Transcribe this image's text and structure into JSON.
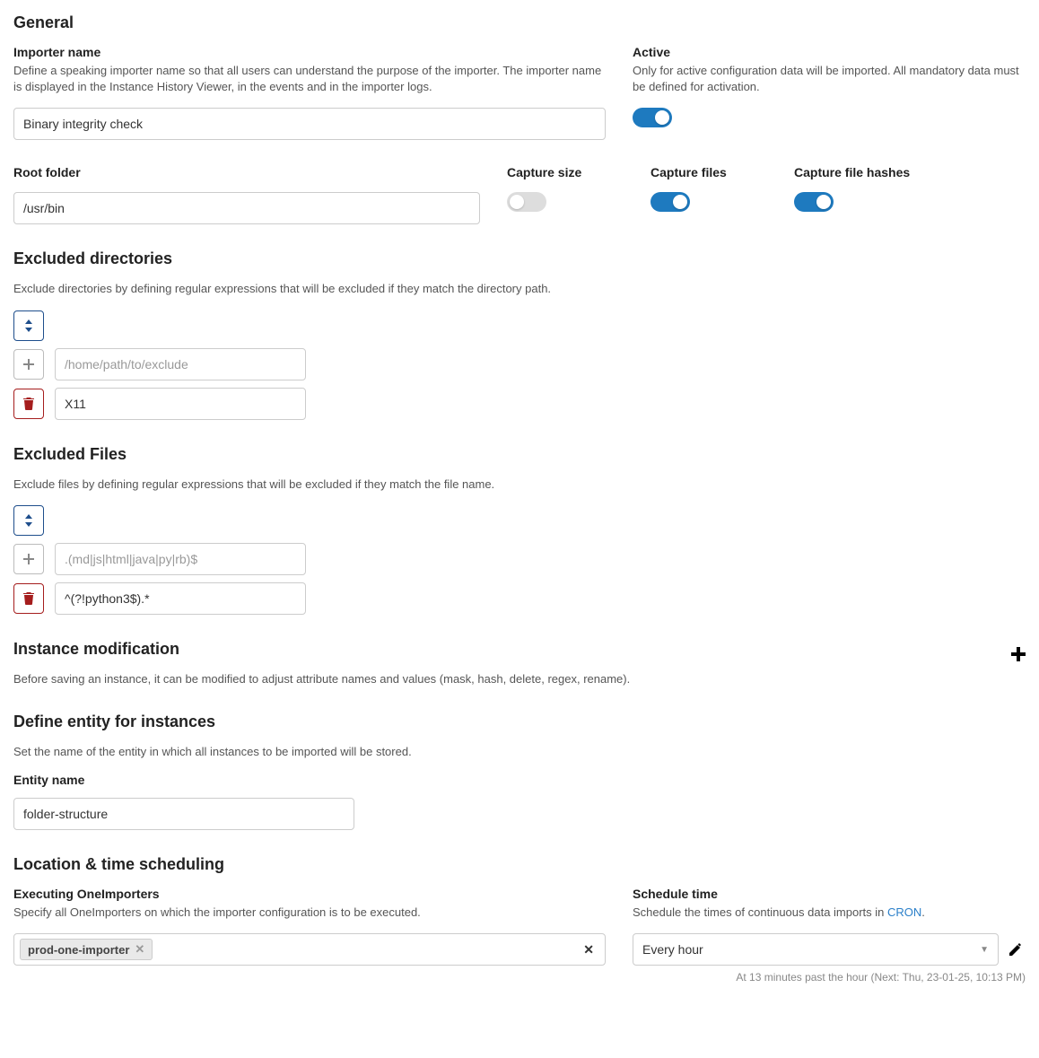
{
  "general": {
    "heading": "General",
    "importer_name": {
      "label": "Importer name",
      "desc": "Define a speaking importer name so that all users can understand the purpose of the importer. The importer name is displayed in the Instance History Viewer, in the events and in the importer logs.",
      "value": "Binary integrity check"
    },
    "active": {
      "label": "Active",
      "desc": "Only for active configuration data will be imported. All mandatory data must be defined for activation."
    },
    "root_folder": {
      "label": "Root folder",
      "value": "/usr/bin"
    },
    "capture_size": {
      "label": "Capture size"
    },
    "capture_files": {
      "label": "Capture files"
    },
    "capture_file_hashes": {
      "label": "Capture file hashes"
    }
  },
  "excluded_dirs": {
    "heading": "Excluded directories",
    "desc": "Exclude directories by defining regular expressions that will be excluded if they match the directory path.",
    "placeholder": "/home/path/to/exclude",
    "items": [
      "X11"
    ]
  },
  "excluded_files": {
    "heading": "Excluded Files",
    "desc": "Exclude files by defining regular expressions that will be excluded if they match the file name.",
    "placeholder": ".(md|js|html|java|py|rb)$",
    "items": [
      "^(?!python3$).*"
    ]
  },
  "instance_modification": {
    "heading": "Instance modification",
    "desc": "Before saving an instance, it can be modified to adjust attribute names and values (mask, hash, delete, regex, rename)."
  },
  "define_entity": {
    "heading": "Define entity for instances",
    "desc": "Set the name of the entity in which all instances to be imported will be stored.",
    "entity_name_label": "Entity name",
    "entity_name_value": "folder-structure"
  },
  "scheduling": {
    "heading": "Location & time scheduling",
    "executing": {
      "label": "Executing OneImporters",
      "desc": "Specify all OneImporters on which the importer configuration is to be executed.",
      "tag": "prod-one-importer"
    },
    "schedule": {
      "label": "Schedule time",
      "desc_prefix": "Schedule the times of continuous data imports in ",
      "cron_link": "CRON",
      "desc_suffix": ".",
      "value": "Every hour",
      "hint": "At 13 minutes past the hour (Next: Thu, 23-01-25, 10:13 PM)"
    }
  }
}
